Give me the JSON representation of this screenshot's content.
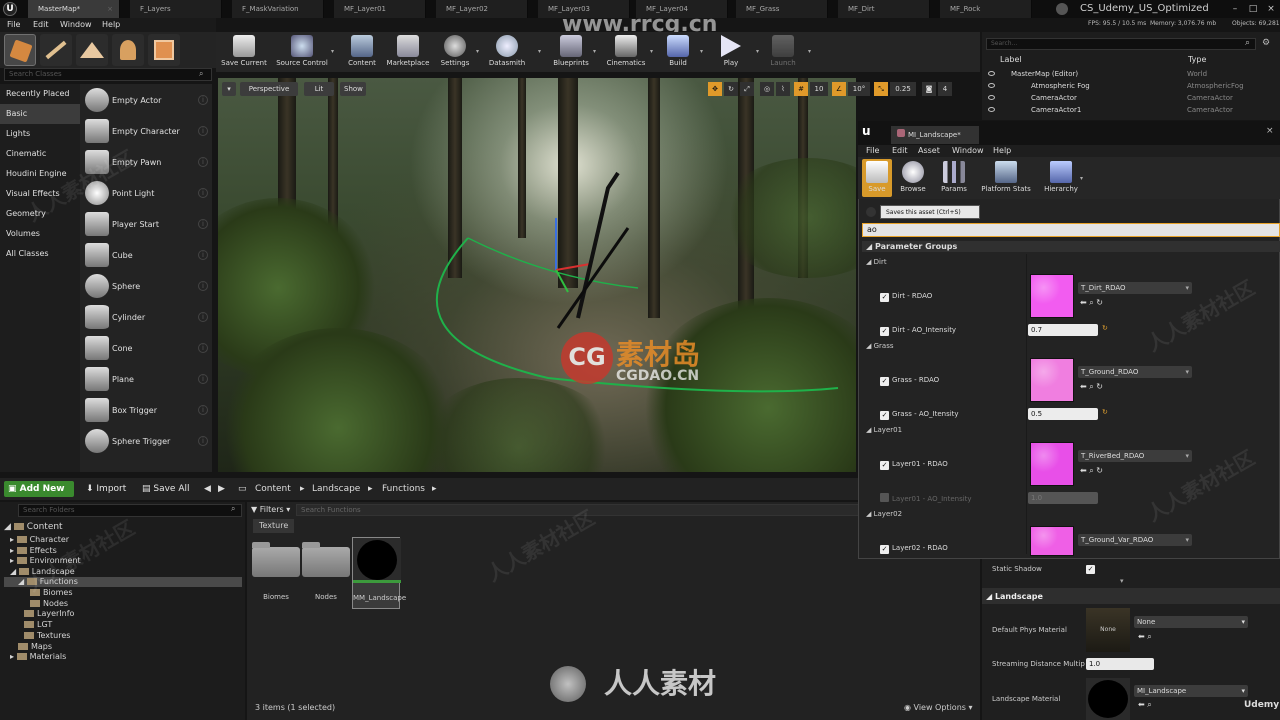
{
  "window": {
    "project_title": "CS_Udemy_US_Optimized",
    "logo": "UE4"
  },
  "doc_tabs": [
    "MasterMap*",
    "F_Layers",
    "F_MaskVariation",
    "MF_Layer01",
    "MF_Layer02",
    "MF_Layer03",
    "MF_Layer04",
    "MF_Grass",
    "MF_Dirt",
    "MF_Rock"
  ],
  "menu": [
    "File",
    "Edit",
    "Window",
    "Help"
  ],
  "modes": {
    "search_placeholder": "Search Classes",
    "categories": [
      "Recently Placed",
      "Basic",
      "Lights",
      "Cinematic",
      "Houdini Engine",
      "Visual Effects",
      "Geometry",
      "Volumes",
      "All Classes"
    ],
    "selected_category": "Basic",
    "classes": [
      "Empty Actor",
      "Empty Character",
      "Empty Pawn",
      "Point Light",
      "Player Start",
      "Cube",
      "Sphere",
      "Cylinder",
      "Cone",
      "Plane",
      "Box Trigger",
      "Sphere Trigger"
    ]
  },
  "toolbar": {
    "buttons": [
      "Save Current",
      "Source Control",
      "Content",
      "Marketplace",
      "Settings",
      "Datasmith",
      "Blueprints",
      "Cinematics",
      "Build",
      "Play",
      "Launch"
    ]
  },
  "viewport": {
    "perspective": "Perspective",
    "lit": "Lit",
    "show": "Show",
    "snap_grid": "10",
    "snap_rot": "10°",
    "snap_scale": "0.25",
    "cam_speed": "4"
  },
  "stats": {
    "fps": "FPS: 95.5 / 10.5 ms",
    "mem": "Memory: 3,076.76 mb",
    "objects": "Objects: 69,281"
  },
  "content_browser": {
    "add_new": "Add New",
    "import": "Import",
    "save_all": "Save All",
    "breadcrumb": [
      "Content",
      "Landscape",
      "Functions"
    ],
    "search_folders_placeholder": "Search Folders",
    "filters": "Filters",
    "search_placeholder": "Search Functions",
    "texture_filter": "Texture",
    "tree": [
      "Content",
      "Character",
      "Effects",
      "Environment",
      "Landscape",
      "Functions",
      "Biomes",
      "Nodes",
      "LayerInfo",
      "LGT",
      "Textures",
      "Maps",
      "Materials"
    ],
    "assets": [
      "Biomes",
      "Nodes",
      "MM_Landscape"
    ],
    "status": "3 items (1 selected)",
    "view_options": "View Options"
  },
  "outliner": {
    "search_placeholder": "Search...",
    "col_label": "Label",
    "col_type": "Type",
    "rows": [
      {
        "label": "MasterMap (Editor)",
        "type": "World"
      },
      {
        "label": "Atmospheric Fog",
        "type": "AtmosphericFog"
      },
      {
        "label": "CameraActor",
        "type": "CameraActor"
      },
      {
        "label": "CameraActor1",
        "type": "CameraActor"
      }
    ]
  },
  "mi_editor": {
    "tab": "MI_Landscape*",
    "menu": [
      "File",
      "Edit",
      "Asset",
      "Window",
      "Help"
    ],
    "toolbar": [
      "Save",
      "Browse",
      "Params",
      "Platform Stats",
      "Hierarchy"
    ],
    "tooltip": "Saves this asset (Ctrl+S)",
    "search_value": "ao",
    "param_groups": "Parameter Groups",
    "groups": [
      {
        "name": "Dirt",
        "tex_label": "Dirt - RDAO",
        "tex": "T_Dirt_RDAO",
        "ao_label": "Dirt - AO_Intensity",
        "ao": "0.7",
        "tex_color": "#f25cf0"
      },
      {
        "name": "Grass",
        "tex_label": "Grass - RDAO",
        "tex": "T_Ground_RDAO",
        "ao_label": "Grass - AO_Itensity",
        "ao": "0.5",
        "tex_color": "#f07ee0"
      },
      {
        "name": "Layer01",
        "tex_label": "Layer01 - RDAO",
        "tex": "T_RiverBed_RDAO",
        "ao_label": "Layer01 - AO_Intensity",
        "ao": "1.0",
        "tex_color": "#e84fe8"
      },
      {
        "name": "Layer02",
        "tex_label": "Layer02 - RDAO",
        "tex": "T_Ground_Var_RDAO",
        "tex_color": "#ef5fe6"
      }
    ]
  },
  "details": {
    "static_shadow": "Static Shadow",
    "landscape": "Landscape",
    "default_phys": "Default Phys Material",
    "phys_none": "None",
    "thumb_none": "None",
    "stream_dist": "Streaming Distance Multip",
    "stream_val": "1.0",
    "landscape_mat": "Landscape Material",
    "mat_val": "MI_Landscape"
  },
  "watermarks": {
    "cg": "CG",
    "site": "素材岛",
    "site_en": "CGDAO.CN",
    "rrcg": "www.rrcg.cn",
    "bottom": "人人素材",
    "udemy": "Udemy"
  }
}
